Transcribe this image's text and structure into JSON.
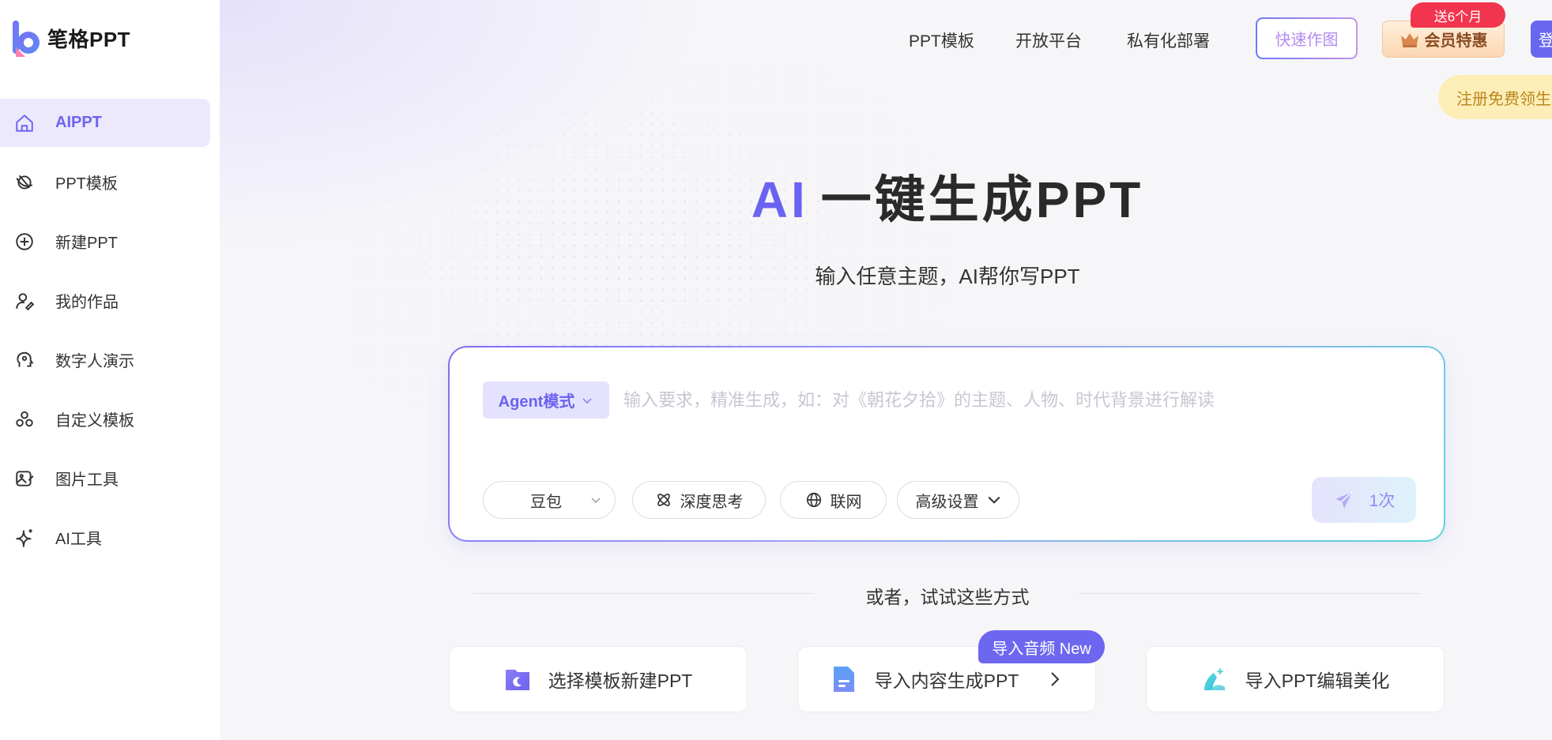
{
  "app": {
    "logo_text": "笔格PPT"
  },
  "sidebar": {
    "items": [
      {
        "label": "AIPPT",
        "icon": "home-icon",
        "active": true
      },
      {
        "label": "PPT模板",
        "icon": "template-icon",
        "active": false
      },
      {
        "label": "新建PPT",
        "icon": "plus-circle-icon",
        "active": false
      },
      {
        "label": "我的作品",
        "icon": "user-edit-icon",
        "active": false
      },
      {
        "label": "数字人演示",
        "icon": "digital-human-icon",
        "active": false
      },
      {
        "label": "自定义模板",
        "icon": "shapes-icon",
        "active": false
      },
      {
        "label": "图片工具",
        "icon": "image-edit-icon",
        "active": false
      },
      {
        "label": "AI工具",
        "icon": "sparkle-icon",
        "active": false
      }
    ]
  },
  "topnav": {
    "links": [
      "PPT模板",
      "开放平台",
      "私有化部署"
    ],
    "quick_draw": "快速作图",
    "vip_label": "会员特惠",
    "vip_badge": "送6个月",
    "login": "登",
    "register_banner": "注册免费领生"
  },
  "hero": {
    "title_ai": "AI",
    "title_rest": "一键生成PPT",
    "subtitle": "输入任意主题，AI帮你写PPT"
  },
  "input_card": {
    "mode_label": "Agent模式",
    "placeholder": "输入要求，精准生成，如：对《朝花夕拾》的主题、人物、时代背景进行解读",
    "value": "",
    "model_select": "豆包",
    "deep_think": "深度思考",
    "web": "联网",
    "advanced": "高级设置",
    "send_count": "1次"
  },
  "alt": {
    "or_text": "或者，试试这些方式",
    "actions": [
      {
        "label": "选择模板新建PPT",
        "icon": "folder-icon"
      },
      {
        "label": "导入内容生成PPT",
        "icon": "document-icon",
        "tag": "导入音频 New"
      },
      {
        "label": "导入PPT编辑美化",
        "icon": "magic-icon"
      }
    ]
  },
  "colors": {
    "accent": "#6c63f0",
    "active_bg": "#ece9fd",
    "badge_red": "#f2344e",
    "vip_text": "#8a4a22",
    "register_bg": "#fdeeb8"
  }
}
